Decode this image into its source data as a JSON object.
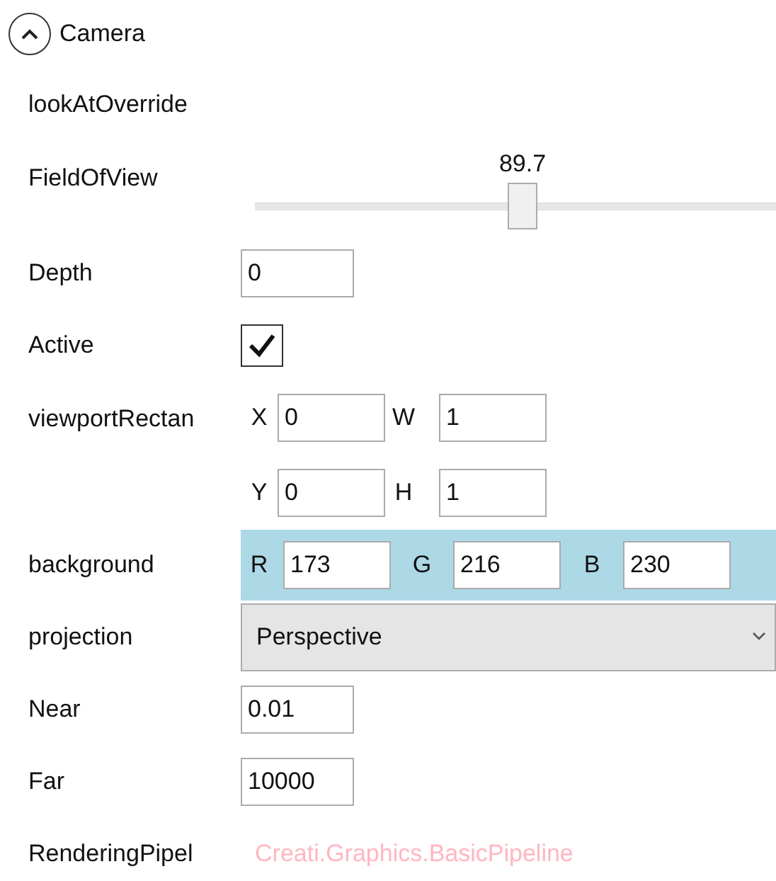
{
  "section": {
    "title": "Camera",
    "expanded": true
  },
  "properties": [
    {
      "kind": "label",
      "name": "lookAtOverride"
    },
    {
      "kind": "slider",
      "name": "FieldOfView",
      "reading": "89.7",
      "level": 0.5
    },
    {
      "kind": "text",
      "name": "Depth",
      "value": "0"
    },
    {
      "kind": "check",
      "name": "Active",
      "checked": true
    },
    {
      "kind": "rect",
      "name": "viewportRectan",
      "fields": [
        {
          "axis": "X",
          "value": "0"
        },
        {
          "axis": "W",
          "value": "1"
        },
        {
          "axis": "Y",
          "value": "0"
        },
        {
          "axis": "H",
          "value": "1"
        }
      ]
    },
    {
      "kind": "color",
      "name": "background",
      "color": "#add8e6",
      "fields": [
        {
          "axis": "R",
          "value": "173"
        },
        {
          "axis": "G",
          "value": "216"
        },
        {
          "axis": "B",
          "value": "230"
        }
      ]
    },
    {
      "kind": "select",
      "name": "projection",
      "value": "Perspective"
    },
    {
      "kind": "text",
      "name": "Near",
      "value": "0.01"
    },
    {
      "kind": "text",
      "name": "Far",
      "value": "10000"
    },
    {
      "kind": "link",
      "name": "RenderingPipel",
      "value": "Creati.Graphics.BasicPipeline"
    }
  ]
}
